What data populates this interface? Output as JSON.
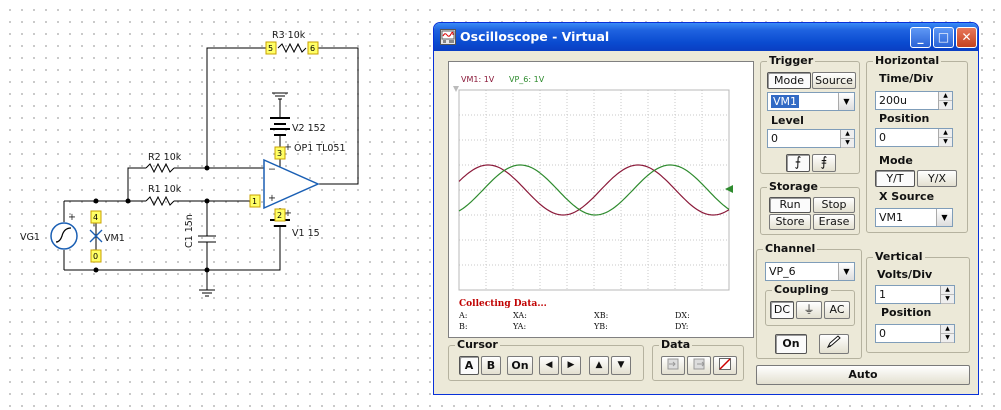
{
  "schematic": {
    "parts": {
      "r3": "R3 10k",
      "r2": "R2 10k",
      "r1": "R1 10k",
      "v2": "V2 152",
      "op1": "OP1 TL051",
      "v1": "V1 15",
      "c1": "C1 15n",
      "vg1": "VG1",
      "vm1": "VM1"
    },
    "pins": {
      "p5": "5",
      "p6": "6",
      "p3": "3",
      "p1": "1",
      "p2": "2",
      "p4": "4",
      "p0": "0"
    }
  },
  "window": {
    "title": "Oscilloscope - Virtual",
    "controls": {
      "minimize": "_",
      "maximize": "□",
      "close": "✕"
    }
  },
  "screen": {
    "legend_vm1": "VM1: 1V",
    "legend_vp6": "VP_6: 1V",
    "status": "Collecting Data...",
    "readouts": {
      "a": "A:",
      "b": "B:",
      "xa": "XA:",
      "ya": "YA:",
      "xb": "XB:",
      "yb": "YB:",
      "dx": "DX:",
      "dy": "DY:"
    },
    "trace_colors": {
      "vm1": "#8b1a3a",
      "vp6": "#2e8b2e"
    }
  },
  "trigger": {
    "title": "Trigger",
    "mode_label": "Mode",
    "source_label": "Source",
    "source_value": "VM1",
    "level_label": "Level",
    "level_value": "0",
    "rising_icon": "rising-edge-icon",
    "falling_icon": "falling-edge-icon"
  },
  "horizontal": {
    "title": "Horizontal",
    "timediv_label": "Time/Div",
    "timediv_value": "200u",
    "position_label": "Position",
    "position_value": "0",
    "mode_label": "Mode",
    "mode_yt": "Y/T",
    "mode_yx": "Y/X",
    "xsource_label": "X Source",
    "xsource_value": "VM1"
  },
  "storage": {
    "title": "Storage",
    "run": "Run",
    "stop": "Stop",
    "store": "Store",
    "erase": "Erase"
  },
  "channel": {
    "title": "Channel",
    "value": "VP_6",
    "coupling_title": "Coupling",
    "dc": "DC",
    "gnd": "⏚",
    "ac": "AC",
    "on": "On"
  },
  "vertical": {
    "title": "Vertical",
    "voltsdiv_label": "Volts/Div",
    "voltsdiv_value": "1",
    "position_label": "Position",
    "position_value": "0"
  },
  "cursor": {
    "title": "Cursor",
    "a": "A",
    "b": "B",
    "on": "On",
    "left": "◀",
    "right": "▶",
    "up": "▲",
    "down": "▼"
  },
  "data": {
    "title": "Data"
  },
  "auto": "Auto"
}
